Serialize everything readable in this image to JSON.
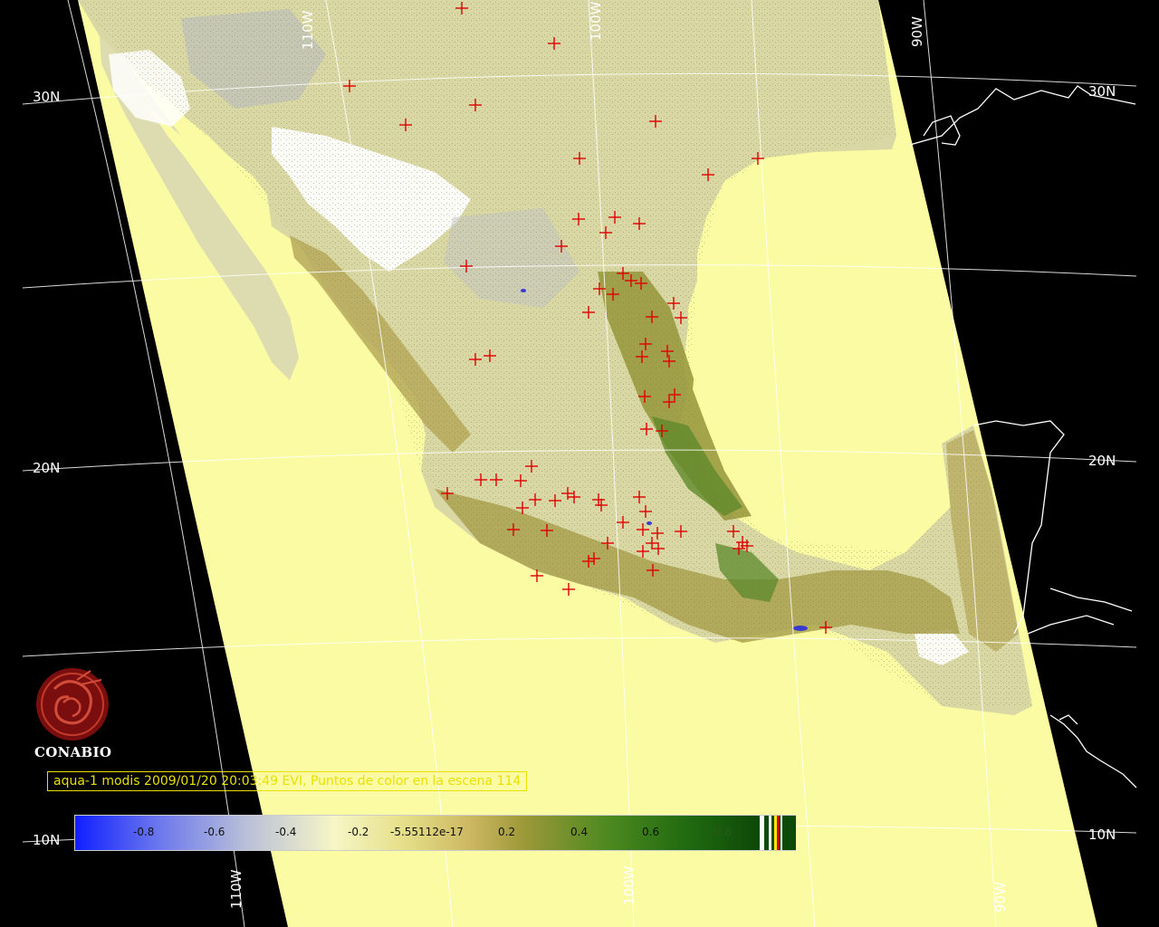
{
  "map": {
    "latitude_labels_left": [
      "30N",
      "20N",
      "10N"
    ],
    "latitude_labels_right": [
      "30N",
      "20N",
      "10N"
    ],
    "longitude_labels_top": [
      "110W",
      "100W",
      "90W"
    ],
    "longitude_labels_bottom": [
      "110W",
      "100W",
      "90W"
    ],
    "colors": {
      "background": "#000000",
      "ocean_swath": "#fbfba3",
      "coastline": "#ffffff",
      "graticule": "#ffffff",
      "hotspot_marker": "#e00000",
      "caption": "#e8e000"
    },
    "hotspot_count": 114
  },
  "branding": {
    "org_name": "CONABIO",
    "logo_icon": "conabio-logo-icon"
  },
  "caption": {
    "text": "aqua-1 modis 2009/01/20 20:03:49 EVI, Puntos de color en la escena 114"
  },
  "colorbar": {
    "tick_labels": [
      "-0.8",
      "-0.6",
      "-0.4",
      "-0.2",
      "-5.55112e-17",
      "0.2",
      "0.4",
      "0.6",
      "0.8"
    ],
    "range": [
      -1.0,
      1.0
    ]
  }
}
